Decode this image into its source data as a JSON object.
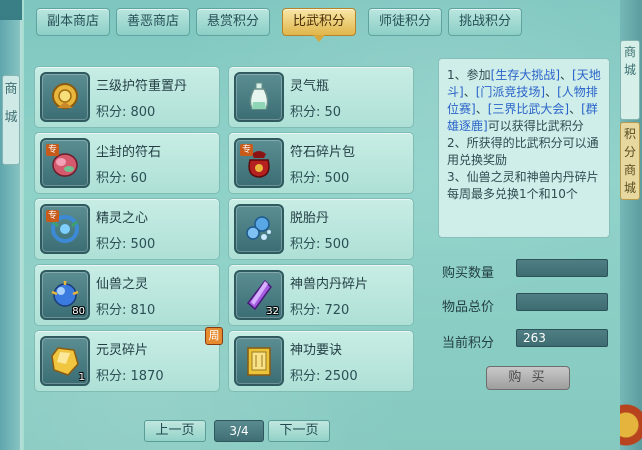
{
  "left_side": {
    "tag_chars": [
      "商",
      "城"
    ]
  },
  "right_side": {
    "tag1_chars": [
      "商",
      "城"
    ],
    "tag2_chars": [
      "积",
      "分",
      "商",
      "城"
    ]
  },
  "tabs": [
    {
      "label": "副本商店",
      "active": false
    },
    {
      "label": "善恶商店",
      "active": false
    },
    {
      "label": "悬赏积分",
      "active": false
    },
    {
      "label": "比武积分",
      "active": true
    },
    {
      "label": "师徒积分",
      "active": false
    },
    {
      "label": "挑战积分",
      "active": false
    }
  ],
  "points_label": "积分: ",
  "items": [
    {
      "name": "三级护符重置丹",
      "points": "800",
      "icon": "gold-charm-icon",
      "qty": "",
      "zhuan": false,
      "weekly": false
    },
    {
      "name": "灵气瓶",
      "points": "50",
      "icon": "spirit-bottle-icon",
      "qty": "",
      "zhuan": false,
      "weekly": false
    },
    {
      "name": "尘封的符石",
      "points": "60",
      "icon": "sealed-rune-stone-icon",
      "qty": "",
      "zhuan": true,
      "weekly": false
    },
    {
      "name": "符石碎片包",
      "points": "500",
      "icon": "rune-fragment-bag-icon",
      "qty": "",
      "zhuan": true,
      "weekly": false
    },
    {
      "name": "精灵之心",
      "points": "500",
      "icon": "spirit-heart-icon",
      "qty": "",
      "zhuan": true,
      "weekly": false
    },
    {
      "name": "脱胎丹",
      "points": "500",
      "icon": "rebirth-pill-icon",
      "qty": "",
      "zhuan": false,
      "weekly": false
    },
    {
      "name": "仙兽之灵",
      "points": "810",
      "icon": "beast-spirit-orb-icon",
      "qty": "80",
      "zhuan": false,
      "weekly": false
    },
    {
      "name": "神兽内丹碎片",
      "points": "720",
      "icon": "purple-crystal-icon",
      "qty": "32",
      "zhuan": false,
      "weekly": false
    },
    {
      "name": "元灵碎片",
      "points": "1870",
      "icon": "gold-fragment-icon",
      "qty": "1",
      "zhuan": false,
      "weekly": true
    },
    {
      "name": "神功要诀",
      "points": "2500",
      "icon": "skill-book-icon",
      "qty": "",
      "zhuan": false,
      "weekly": false
    }
  ],
  "zhuan_label": "专",
  "weekly_label": "周",
  "info": {
    "line1_prefix": "1、参加",
    "events": [
      "[生存大挑战]",
      "[天地斗]",
      "[门派竞技场]",
      "[人物排位赛]",
      "[三界比武大会]",
      "[群雄逐鹿]"
    ],
    "sep": "、",
    "line1_suffix": "可以获得比武积分",
    "line2": "2、所获得的比武积分可以通用兑换奖励",
    "line3": "3、仙兽之灵和神兽内丹碎片每周最多兑换1个和10个"
  },
  "form": {
    "buy_qty_label": "购买数量",
    "buy_qty_value": "",
    "total_label": "物品总价",
    "total_value": "",
    "current_label": "当前积分",
    "current_value": "263"
  },
  "buy_button": "购 买",
  "pager": {
    "prev": "上一页",
    "indicator": "3/4",
    "next": "下一页"
  },
  "colors": {
    "active_tab": "#e0b64a",
    "highlight_text": "#2a63c9",
    "panel_bg": "#8fd2c9"
  }
}
